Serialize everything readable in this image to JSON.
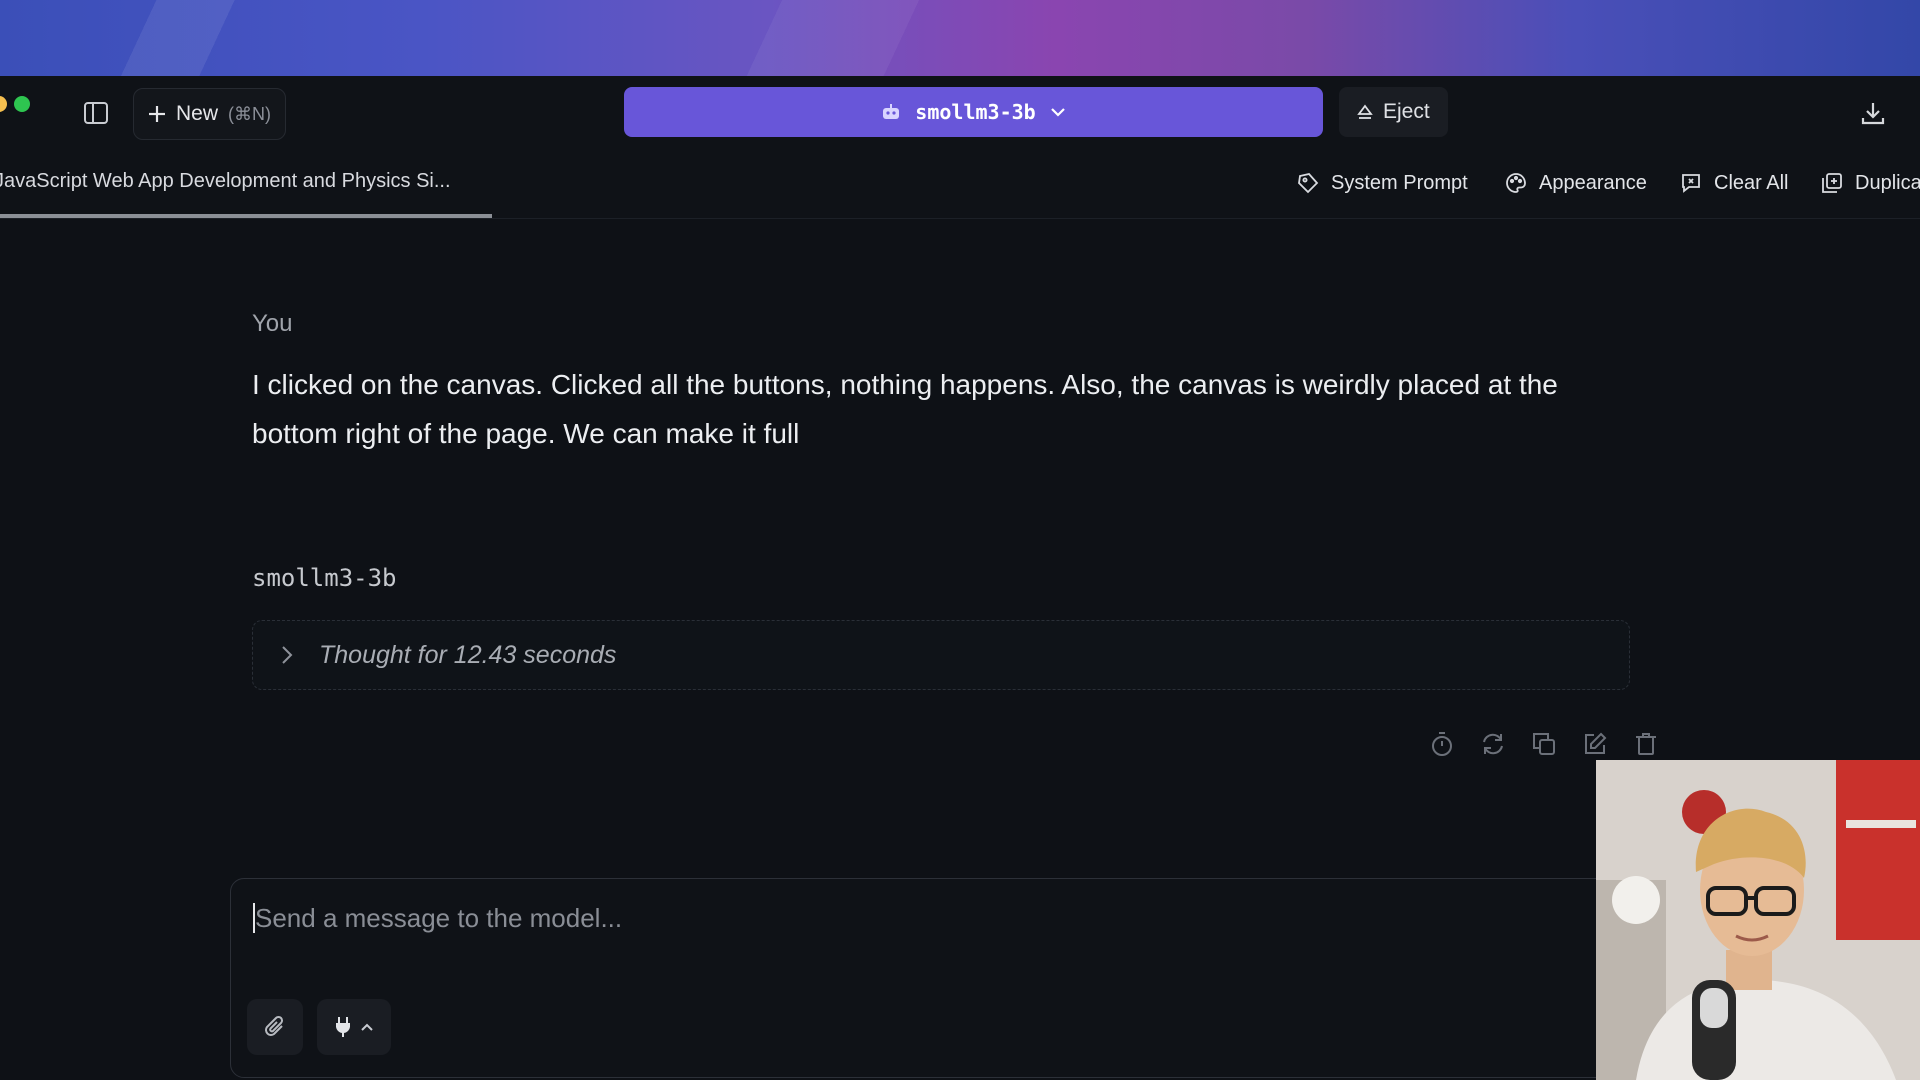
{
  "titlebar": {
    "new_label": "New",
    "new_shortcut": "(⌘N)",
    "model_name": "smollm3-3b",
    "eject_label": "Eject"
  },
  "tabrow": {
    "chat_title": "JavaScript Web App Development and Physics Si...",
    "tools": {
      "system_prompt": "System Prompt",
      "appearance": "Appearance",
      "clear_all": "Clear All",
      "duplicate": "Duplicate"
    }
  },
  "conversation": {
    "user_label": "You",
    "user_message": "I clicked on the canvas. Clicked all the buttons, nothing happens. Also, the canvas is weirdly placed at the bottom right of the page. We can make it full",
    "model_label": "smollm3-3b",
    "thought_text": "Thought for 12.43 seconds"
  },
  "composer": {
    "placeholder": "Send a message to the model..."
  },
  "colors": {
    "accent": "#6856d9",
    "background": "#0e1116",
    "traffic_yellow": "#f5bf4f",
    "traffic_green": "#2ec550"
  },
  "icons": [
    "sidebar-toggle-icon",
    "plus-icon",
    "robot-icon",
    "chevron-down-icon",
    "eject-icon",
    "download-icon",
    "system-prompt-icon",
    "palette-icon",
    "clear-all-icon",
    "duplicate-icon",
    "chevron-right-icon",
    "timer-icon",
    "regenerate-icon",
    "copy-icon",
    "edit-icon",
    "trash-icon",
    "paperclip-icon",
    "plug-icon",
    "chevron-up-icon"
  ]
}
